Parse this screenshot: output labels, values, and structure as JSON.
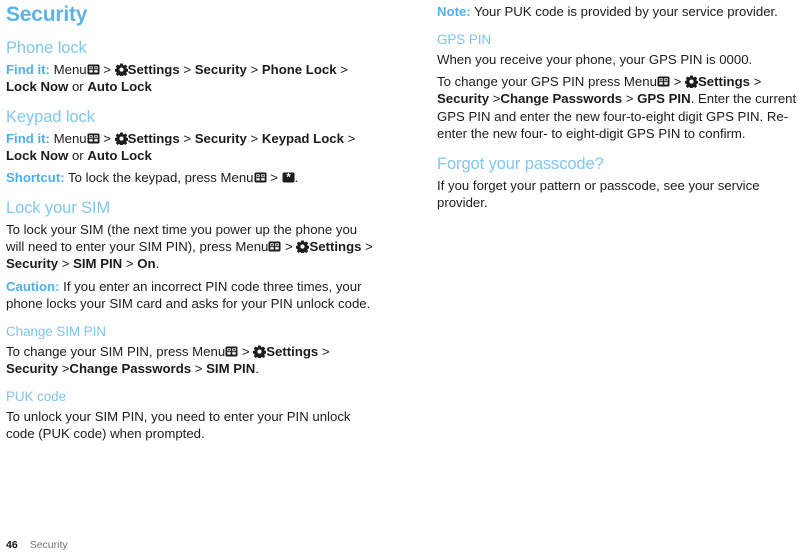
{
  "page": {
    "title": "Security",
    "footer": {
      "page_number": "46",
      "section": "Security"
    }
  },
  "colors": {
    "title_blue": "#5cb2e6",
    "heading_blue": "#81c6ee",
    "subheading_blue": "#7ec4ed",
    "lead_blue": "#4fb0e8",
    "body_text": "#1c1c1c",
    "footer_gray": "#747474"
  },
  "icons": {
    "menu": "menu-key-icon",
    "settings": "gear-icon",
    "star_key": "star-key-icon"
  },
  "left_column": {
    "phone_lock": {
      "heading": "Phone lock",
      "find_it_label": "Find it:",
      "path": {
        "menu": "Menu",
        "settings": "Settings",
        "security": "Security",
        "item": "Phone Lock",
        "lock_now": "Lock Now",
        "or": "or",
        "auto_lock": "Auto Lock"
      }
    },
    "keypad_lock": {
      "heading": "Keypad lock",
      "find_it_label": "Find it:",
      "path": {
        "menu": "Menu",
        "settings": "Settings",
        "security": "Security",
        "item": "Keypad Lock",
        "lock_now": "Lock Now",
        "or": "or",
        "auto_lock": "Auto Lock"
      },
      "shortcut_label": "Shortcut:",
      "shortcut_text_before": "To lock the keypad, press Menu",
      "shortcut_text_after": "."
    },
    "lock_your_sim": {
      "heading": "Lock your SIM",
      "intro": "To lock your SIM (the next time you power up the phone you will need to enter your SIM PIN), press Menu",
      "path": {
        "settings": "Settings",
        "security": "Security",
        "sim_pin": "SIM PIN",
        "on": "On"
      },
      "trailing_period": ".",
      "caution_label": "Caution:",
      "caution_text": "If you enter an incorrect PIN code three times, your phone locks your SIM card and asks for your PIN unlock code."
    },
    "change_sim_pin": {
      "heading": "Change SIM PIN",
      "intro": "To change your SIM PIN, press Menu",
      "path": {
        "settings": "Settings",
        "security": "Security",
        "change_passwords": "Change Passwords",
        "sim_pin": "SIM PIN"
      },
      "trailing_period": "."
    },
    "puk_code": {
      "heading": "PUK code",
      "text": "To unlock your SIM PIN, you need to enter your PIN unlock code (PUK code) when prompted."
    }
  },
  "right_column": {
    "note": {
      "label": "Note:",
      "text": "Your PUK code is provided by your service provider."
    },
    "gps_pin": {
      "heading": "GPS PIN",
      "intro": "When you receive your phone, your GPS PIN is 0000.",
      "change_intro": "To change your GPS PIN press Menu",
      "path": {
        "settings": "Settings",
        "security": "Security",
        "change_passwords": "Change Passwords",
        "gps_pin": "GPS PIN"
      },
      "after_path": ". Enter the current GPS PIN and enter the new four-to-eight digit GPS PIN. Re-enter the new four- to eight-digit GPS PIN to confirm."
    },
    "forgot_passcode": {
      "heading": "Forgot your passcode?",
      "text": "If you forget your pattern or passcode, see your service provider."
    }
  },
  "separators": {
    "gt": ">",
    "gt_nospace": ">"
  }
}
